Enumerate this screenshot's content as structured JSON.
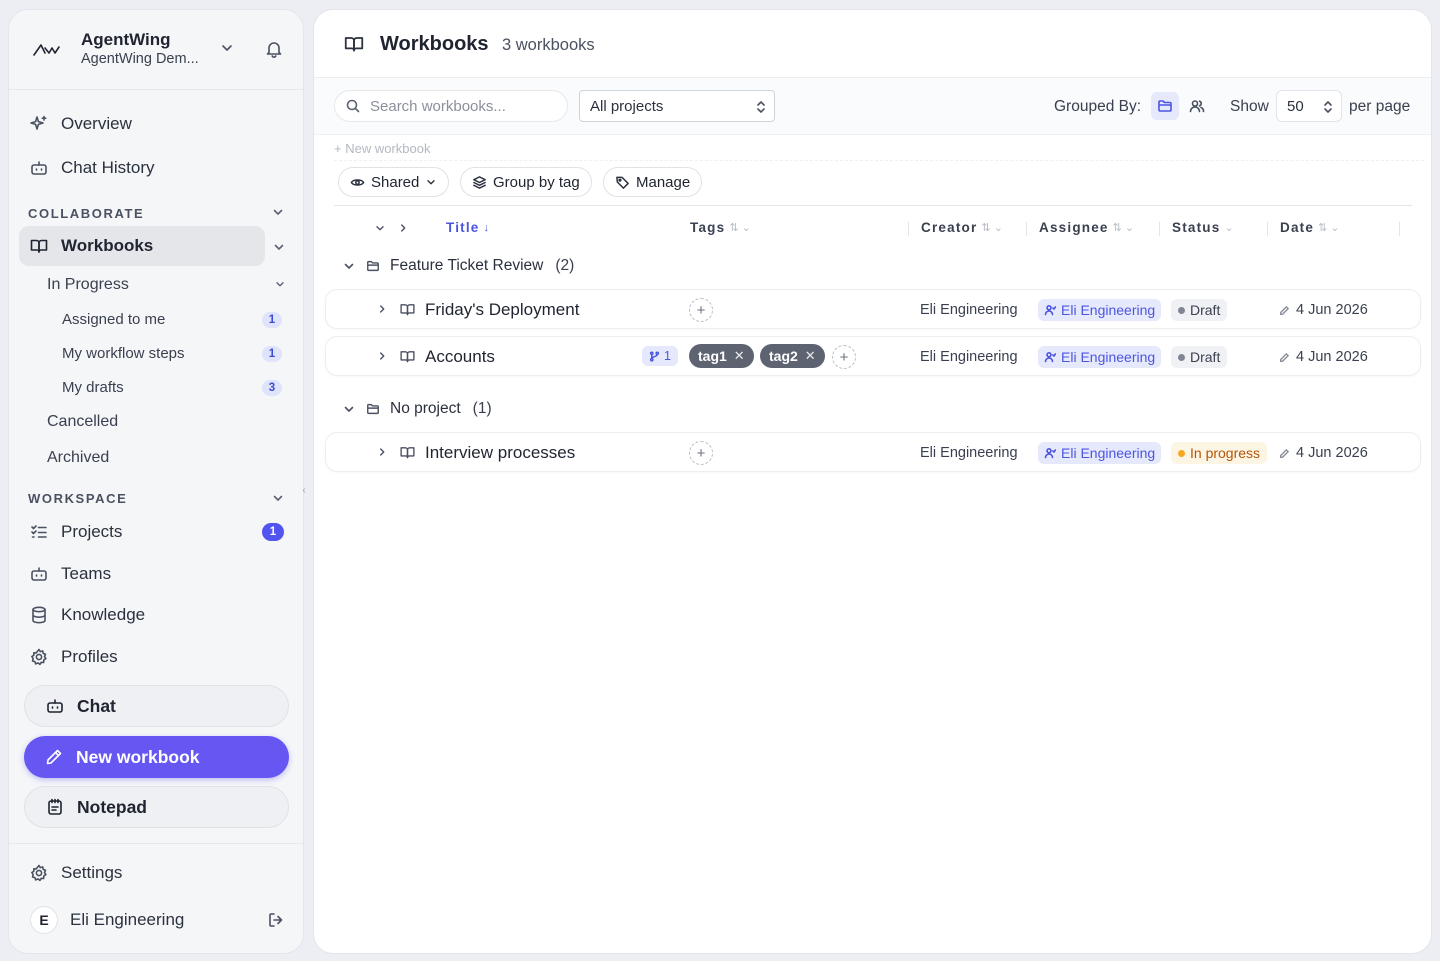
{
  "sidebar": {
    "brand": {
      "name": "AgentWing",
      "subtitle": "AgentWing Dem..."
    },
    "nav_top": [
      {
        "label": "Overview",
        "icon": "sparkle-icon"
      },
      {
        "label": "Chat History",
        "icon": "bot-icon"
      }
    ],
    "collaborate": {
      "label": "COLLABORATE",
      "workbooks": "Workbooks",
      "in_progress": "In Progress",
      "in_progress_items": [
        {
          "label": "Assigned to me",
          "count": "1"
        },
        {
          "label": "My workflow steps",
          "count": "1"
        },
        {
          "label": "My drafts",
          "count": "3"
        }
      ],
      "cancelled": "Cancelled",
      "archived": "Archived"
    },
    "workspace": {
      "label": "WORKSPACE",
      "items": [
        {
          "label": "Projects",
          "icon": "list-check-icon",
          "count": "1"
        },
        {
          "label": "Teams",
          "icon": "bot-icon"
        },
        {
          "label": "Knowledge",
          "icon": "database-icon"
        },
        {
          "label": "Profiles",
          "icon": "gear-icon"
        }
      ]
    },
    "buttons": {
      "chat": "Chat",
      "new_workbook": "New workbook",
      "notepad": "Notepad"
    },
    "settings": "Settings",
    "user": {
      "initial": "E",
      "name": "Eli Engineering"
    }
  },
  "main": {
    "title": "Workbooks",
    "count": "3 workbooks",
    "toolbar": {
      "search_placeholder": "Search workbooks...",
      "project_filter": "All projects",
      "grouped_by": "Grouped By:",
      "show": "Show",
      "per_page_value": "50",
      "per_page": "per page"
    },
    "new_workbook_link": "+ New workbook",
    "chips": {
      "shared": "Shared",
      "group_by_tag": "Group by tag",
      "manage": "Manage"
    },
    "columns": {
      "title": "Title",
      "tags": "Tags",
      "creator": "Creator",
      "assignee": "Assignee",
      "status": "Status",
      "date": "Date"
    },
    "groups": [
      {
        "name": "Feature Ticket Review",
        "count": "(2)",
        "rows": [
          {
            "title": "Friday's Deployment",
            "creator": "Eli Engineering",
            "assignee": "Eli Engineering",
            "status": "Draft",
            "date": "4 Jun 2026"
          },
          {
            "title": "Accounts",
            "branches": "1",
            "tags": [
              "tag1",
              "tag2"
            ],
            "creator": "Eli Engineering",
            "assignee": "Eli Engineering",
            "status": "Draft",
            "date": "4 Jun 2026"
          }
        ]
      },
      {
        "name": "No project",
        "count": "(1)",
        "rows": [
          {
            "title": "Interview processes",
            "creator": "Eli Engineering",
            "assignee": "Eli Engineering",
            "status": "In progress",
            "date": "4 Jun 2026"
          }
        ]
      }
    ]
  },
  "colors": {
    "accent": "#6657f2",
    "accent_text": "#4b56e0",
    "badge_bg": "#e6e9fc",
    "tag_bg": "#5d6370",
    "in_progress": "#b3540a"
  }
}
